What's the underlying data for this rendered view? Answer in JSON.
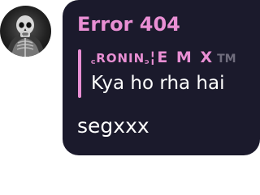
{
  "message": {
    "sender_name": "Error 404",
    "reply": {
      "author_small": "꜀RONIN꜆",
      "author_sep": "¦",
      "author_big": "E M X",
      "author_badge": "TM",
      "text": "Kya ho rha hai"
    },
    "text": "segxxx"
  },
  "colors": {
    "bubble_bg": "#1b1a2c",
    "accent_pink": "#e98fd4",
    "text_white": "#ffffff",
    "badge_gray": "#6f6c7c"
  },
  "avatar": {
    "icon": "skull-avatar-icon"
  }
}
